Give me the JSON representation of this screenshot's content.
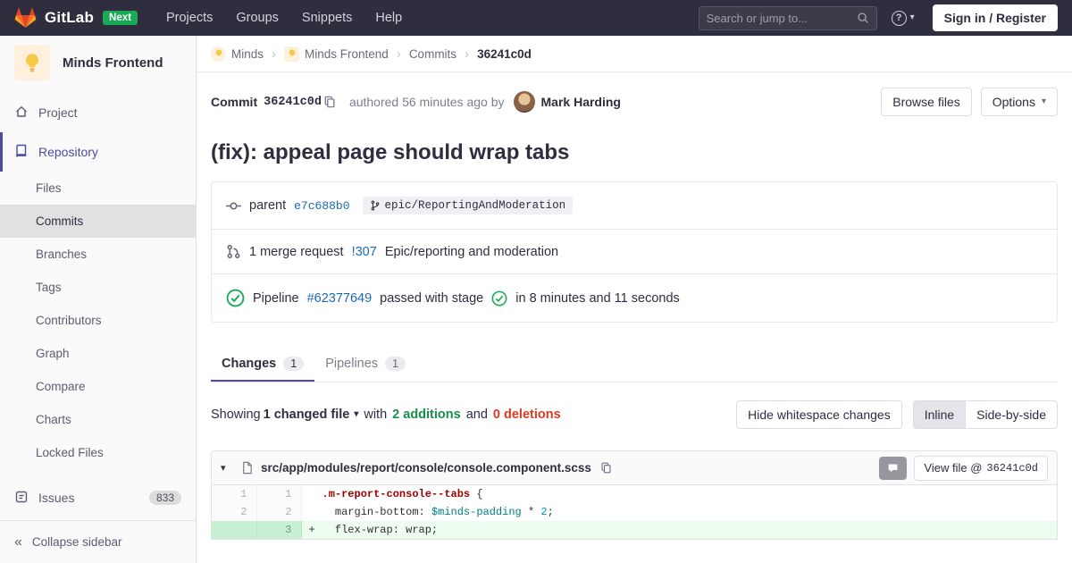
{
  "colors": {
    "navbar_bg": "#2e2e3f",
    "link": "#1b69b6",
    "success": "#1aaa55",
    "danger": "#db3b21",
    "sidebar_active": "#4b4ba3",
    "addition_bg": "#ecfdf0",
    "addition_line_number_bg": "#c7f0d2",
    "next_badge_bg": "#1aaa55"
  },
  "glyphs": {
    "caret_down": "▾",
    "breadcrumb_sep": "›",
    "collapse": "«",
    "question_mark": "?"
  },
  "navbar": {
    "brand": "GitLab",
    "next_badge": "Next",
    "links": [
      {
        "label": "Projects"
      },
      {
        "label": "Groups"
      },
      {
        "label": "Snippets"
      },
      {
        "label": "Help"
      }
    ],
    "search_placeholder": "Search or jump to...",
    "signin_label": "Sign in / Register"
  },
  "sidebar": {
    "project_name": "Minds Frontend",
    "project_item": "Project",
    "repository_item": "Repository",
    "repo_subitems": [
      {
        "label": "Files"
      },
      {
        "label": "Commits"
      },
      {
        "label": "Branches"
      },
      {
        "label": "Tags"
      },
      {
        "label": "Contributors"
      },
      {
        "label": "Graph"
      },
      {
        "label": "Compare"
      },
      {
        "label": "Charts"
      },
      {
        "label": "Locked Files"
      }
    ],
    "issues_label": "Issues",
    "issues_count": "833",
    "collapse_label": "Collapse sidebar"
  },
  "breadcrumb": {
    "items": [
      {
        "label": "Minds"
      },
      {
        "label": "Minds Frontend"
      },
      {
        "label": "Commits"
      },
      {
        "label": "36241c0d"
      }
    ]
  },
  "commit": {
    "label": "Commit",
    "sha": "36241c0d",
    "authored_text": "authored 56 minutes ago by",
    "author": "Mark Harding",
    "browse_files_label": "Browse files",
    "options_label": "Options",
    "title": "(fix): appeal page should wrap tabs",
    "parent_label": "parent",
    "parent_sha": "e7c688b0",
    "branch_name": "epic/ReportingAndModeration",
    "mr_count_text": "1 merge request",
    "mr_ref": "!307",
    "mr_title": "Epic/reporting and moderation",
    "pipeline_label": "Pipeline",
    "pipeline_id": "#62377649",
    "pipeline_status_text": "passed with stage",
    "pipeline_duration": "in 8 minutes and 11 seconds"
  },
  "tabs": [
    {
      "label": "Changes",
      "count": "1"
    },
    {
      "label": "Pipelines",
      "count": "1"
    }
  ],
  "summary": {
    "showing": "Showing",
    "changed_files": "1 changed file",
    "with_text": "with",
    "additions": "2 additions",
    "and_text": "and",
    "deletions": "0 deletions",
    "hide_whitespace_label": "Hide whitespace changes",
    "inline_label": "Inline",
    "side_by_side_label": "Side-by-side"
  },
  "diff": {
    "file_path": "src/app/modules/report/console/console.component.scss",
    "view_file_label": "View file @",
    "view_file_sha": "36241c0d",
    "lines": [
      {
        "old": "1",
        "new": "1",
        "sign": "",
        "segments": [
          {
            "text": ".m-report-console--tabs",
            "type": "selector"
          },
          {
            "text": " {",
            "type": "plain"
          }
        ]
      },
      {
        "old": "2",
        "new": "2",
        "sign": "",
        "segments": [
          {
            "text": "  margin-bottom: ",
            "type": "plain"
          },
          {
            "text": "$minds-padding",
            "type": "variable"
          },
          {
            "text": " * ",
            "type": "plain"
          },
          {
            "text": "2",
            "type": "number"
          },
          {
            "text": ";",
            "type": "plain"
          }
        ]
      },
      {
        "old": "",
        "new": "3",
        "sign": "+",
        "segments": [
          {
            "text": "  flex-wrap: wrap;",
            "type": "plain"
          }
        ]
      }
    ]
  }
}
